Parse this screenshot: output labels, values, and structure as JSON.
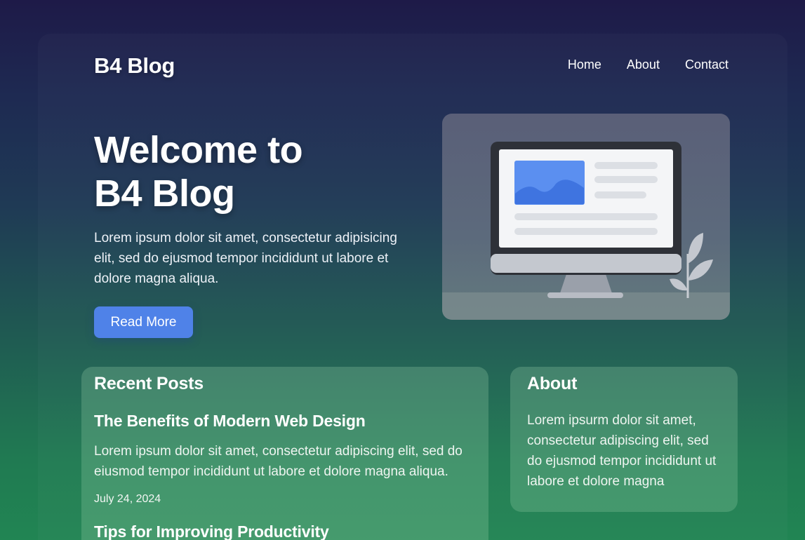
{
  "header": {
    "brand": "B4 Blog",
    "nav": [
      "Home",
      "About",
      "Contact"
    ]
  },
  "hero": {
    "title_line1": "Welcome to",
    "title_line2": "B4 Blog",
    "text": "Lorem ipsum dolor sit amet, consectetur adipisicing elit, sed do ejusmod tempor incididunt ut labore et dolore magna aliqua.",
    "button_label": "Read More",
    "illustration_icon": "computer-monitor-icon"
  },
  "recent_posts": {
    "title": "Recent Posts",
    "posts": [
      {
        "title": "The Benefits of Modern Web Design",
        "excerpt": "Lorem ipsum dolor sit amet, consectetur adipiscing elit, sed  do eiusmod tempor incididunt ut labore et dolore magna aliqua.",
        "date": "July 24, 2024"
      },
      {
        "title": "Tips for Improving Productivity"
      }
    ]
  },
  "about": {
    "title": "About",
    "text": "Lorem ipsurm dolor sit amet, consectetur adipiscing elit, sed do ejusmod tempor incididunt ut labore et dolore magna"
  },
  "colors": {
    "accent": "#4f82e8",
    "background_top": "#1e1a48",
    "background_bottom": "#218553"
  }
}
